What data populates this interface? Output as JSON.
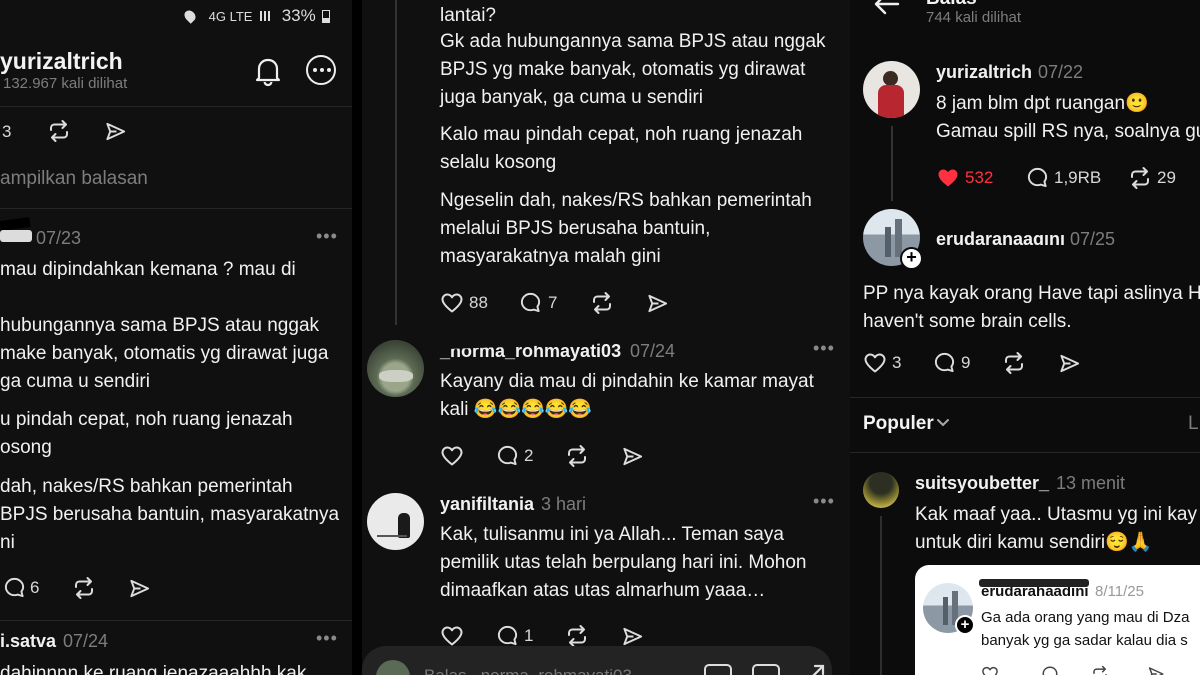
{
  "left": {
    "status_time_icons": "4G LTE",
    "battery": "33%",
    "username": "yurizaltrich",
    "views": "132.967 kali dilihat",
    "top_count": "3",
    "show_replies": "ampilkan balasan",
    "comment1": {
      "date": "07/23",
      "lines": [
        "mau dipindahkan kemana ? mau di",
        "",
        "hubungannya sama BPJS atau nggak",
        " make banyak, otomatis yg dirawat juga",
        "ga cuma u sendiri",
        "",
        "u pindah cepat, noh ruang jenazah",
        "osong",
        "",
        " dah, nakes/RS bahkan pemerintah",
        "BPJS berusaha bantuin, masyarakatnya",
        "ni"
      ],
      "replies": "6"
    },
    "comment2": {
      "name": "i.satva",
      "date": "07/24",
      "text": "dahinnnn ke ruang jenazaaahhh kak"
    }
  },
  "middle": {
    "lines_top": [
      "lantai?",
      "Gk ada hubungannya sama BPJS atau nggak",
      "BPJS yg make banyak, otomatis yg dirawat",
      "juga banyak, ga cuma u sendiri"
    ],
    "lines_mid": [
      "Kalo mau pindah cepat, noh ruang jenazah",
      "selalu kosong"
    ],
    "lines_bot": [
      "Ngeselin dah, nakes/RS bahkan pemerintah",
      "melalui BPJS berusaha bantuin,",
      "masyarakatnya malah gini"
    ],
    "likes": "88",
    "replies": "7",
    "c2": {
      "name": "_norma_rohmayati03",
      "date": "07/24",
      "lines": [
        "Kayany dia mau di pindahin ke kamar mayat",
        "kali 😂😂😂😂😂"
      ],
      "replies": "2"
    },
    "c3": {
      "name": "yanifiltania",
      "date": "3 hari",
      "lines": [
        "Kak, tulisanmu ini ya Allah... Teman saya",
        "pemilik utas telah berpulang hari ini. Mohon",
        "dimaafkan atas utas almarhum yaaa…"
      ],
      "replies": "1"
    },
    "reply_placeholder": "Balas _norma_rohmayati03"
  },
  "right": {
    "header_title": "Balas",
    "views": "744 kali dilihat",
    "c1": {
      "name": "yurizaltrich",
      "date": "07/22",
      "lines": [
        "8 jam blm dpt ruangan🙂",
        "Gamau spill RS nya, soalnya gu"
      ],
      "likes": "532",
      "replies": "1,9RB",
      "reposts": "29"
    },
    "c2": {
      "name": "erudarahaadini",
      "date": "07/25",
      "lines": [
        "PP nya kayak orang Have tapi aslinya H",
        "haven't some brain cells."
      ],
      "likes": "3",
      "replies": "9"
    },
    "sort_label": "Populer",
    "c3": {
      "name": "suitsyoubetter_",
      "date": "13 menit",
      "lines": [
        "Kak maaf yaa.. Utasmu yg ini kay",
        "untuk diri kamu sendiri😌🙏"
      ]
    },
    "quote": {
      "name": "erudarahaadini",
      "date": "8/11/25",
      "lines": [
        "Ga ada orang yang mau di Dza",
        "banyak yg ga sadar kalau dia s"
      ]
    }
  },
  "colors": {
    "heart_red": "#ff3040",
    "bg": "#101010",
    "text": "#f1f1f1",
    "muted": "#7d7d7d"
  }
}
